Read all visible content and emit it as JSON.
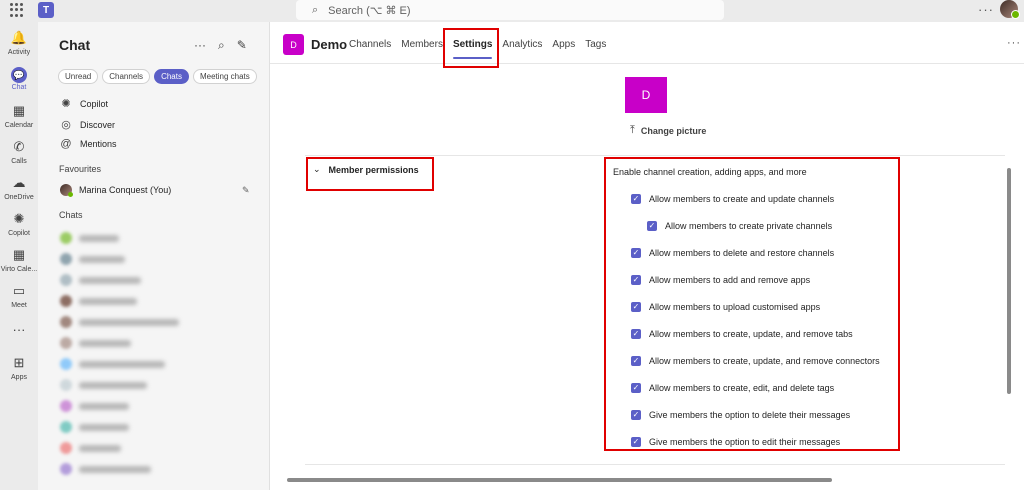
{
  "topbar": {
    "search_placeholder": "Search (⌥ ⌘ E)",
    "more": "···",
    "logo_letter": "T"
  },
  "rail": {
    "items": [
      {
        "label": "Activity",
        "icon": "bell-icon",
        "glyph": "🔔"
      },
      {
        "label": "Chat",
        "icon": "chat-icon",
        "glyph": "💬"
      },
      {
        "label": "Calendar",
        "icon": "calendar-icon",
        "glyph": "▦"
      },
      {
        "label": "Calls",
        "icon": "phone-icon",
        "glyph": "✆"
      },
      {
        "label": "OneDrive",
        "icon": "cloud-icon",
        "glyph": "☁"
      },
      {
        "label": "Copilot",
        "icon": "copilot-icon",
        "glyph": "✺"
      },
      {
        "label": "Virto Cale...",
        "icon": "grid-calendar-icon",
        "glyph": "▦"
      },
      {
        "label": "Meet",
        "icon": "video-icon",
        "glyph": "▭"
      },
      {
        "label": "",
        "icon": "more-icon",
        "glyph": "···"
      },
      {
        "label": "Apps",
        "icon": "plus-box-icon",
        "glyph": "⊞"
      }
    ]
  },
  "chatpane": {
    "title": "Chat",
    "actions": [
      "···",
      "⌕",
      "✎"
    ],
    "filters": [
      "Unread",
      "Channels",
      "Chats",
      "Meeting chats"
    ],
    "active_filter": "Chats",
    "nav": [
      {
        "label": "Copilot",
        "icon": "copilot-icon",
        "glyph": "✺"
      },
      {
        "label": "Discover",
        "icon": "compass-icon",
        "glyph": "◎"
      },
      {
        "label": "Mentions",
        "icon": "at-icon",
        "glyph": "@"
      }
    ],
    "favourites_label": "Favourites",
    "favourite": "Marina Conquest (You)",
    "chats_label": "Chats"
  },
  "main": {
    "team_initial": "D",
    "team_name": "Demo",
    "tabs": [
      "Channels",
      "Members",
      "Settings",
      "Analytics",
      "Apps",
      "Tags"
    ],
    "active_tab": "Settings",
    "more": "···",
    "picture_initial": "D",
    "change_picture": "Change picture",
    "section_title": "Member permissions",
    "intro": "Enable channel creation, adding apps, and more",
    "permissions": [
      {
        "label": "Allow members to create and update channels",
        "checked": true,
        "indent": false
      },
      {
        "label": "Allow members to create private channels",
        "checked": true,
        "indent": true
      },
      {
        "label": "Allow members to delete and restore channels",
        "checked": true,
        "indent": false
      },
      {
        "label": "Allow members to add and remove apps",
        "checked": true,
        "indent": false
      },
      {
        "label": "Allow members to upload customised apps",
        "checked": true,
        "indent": false
      },
      {
        "label": "Allow members to create, update, and remove tabs",
        "checked": true,
        "indent": false
      },
      {
        "label": "Allow members to create, update, and remove connectors",
        "checked": true,
        "indent": false
      },
      {
        "label": "Allow members to create, edit, and delete tags",
        "checked": true,
        "indent": false
      },
      {
        "label": "Give members the option to delete their messages",
        "checked": true,
        "indent": false
      },
      {
        "label": "Give members the option to edit their messages",
        "checked": true,
        "indent": false
      }
    ]
  },
  "colors": {
    "accent": "#5b5fc7",
    "team_badge": "#c800c8",
    "highlight": "#e00000"
  }
}
